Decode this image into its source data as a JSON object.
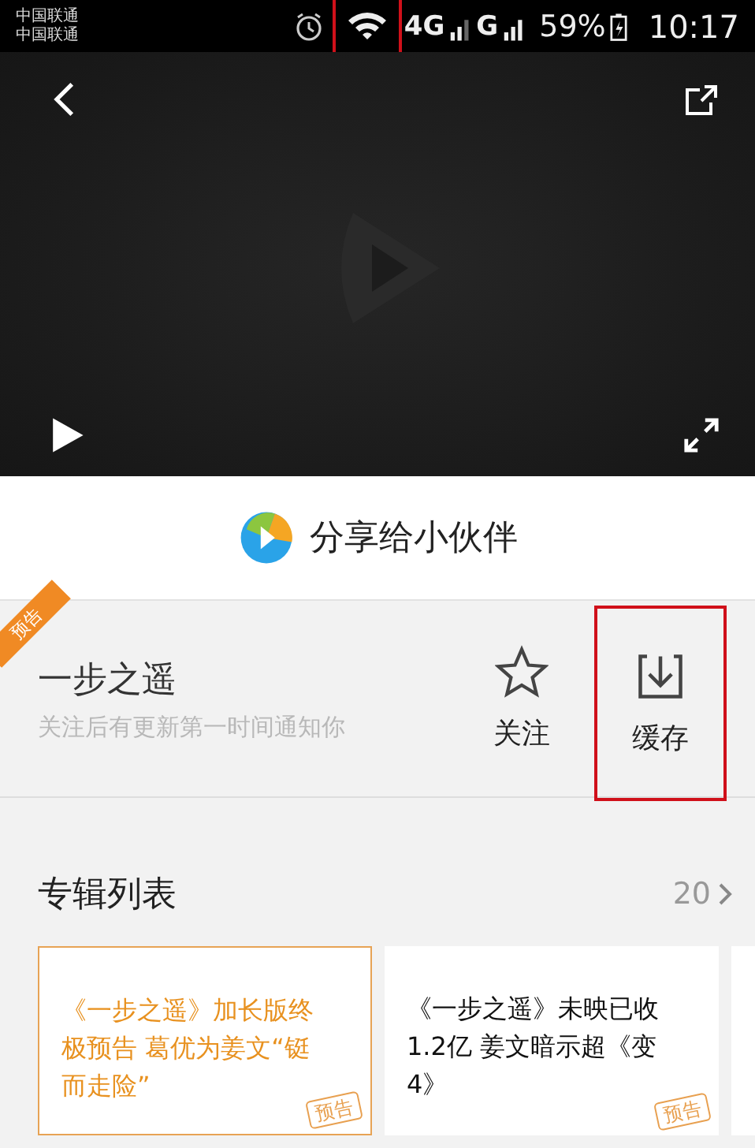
{
  "status_bar": {
    "carriers": [
      "中国联通",
      "中国联通"
    ],
    "wifi_highlighted": true,
    "network_1": "4G",
    "network_2": "G",
    "battery": "59%",
    "time": "10:17"
  },
  "share_row": {
    "label": "分享给小伙伴"
  },
  "show": {
    "ribbon": "预告",
    "title": "一步之遥",
    "subtitle": "关注后有更新第一时间通知你",
    "actions": [
      {
        "kind": "follow",
        "label": "关注",
        "highlighted": false
      },
      {
        "kind": "download",
        "label": "缓存",
        "highlighted": true
      }
    ]
  },
  "album": {
    "title": "专辑列表",
    "count": "20",
    "cards": [
      {
        "kind": "episode",
        "text": "《一步之遥》加长版终极预告 葛优为姜文“铤而走险”",
        "selected": true,
        "badge": "预告"
      },
      {
        "kind": "episode",
        "text": "《一步之遥》未映已收1.2亿 姜文暗示超《变4》",
        "selected": false,
        "badge": "预告"
      },
      {
        "kind": "cut"
      }
    ]
  }
}
